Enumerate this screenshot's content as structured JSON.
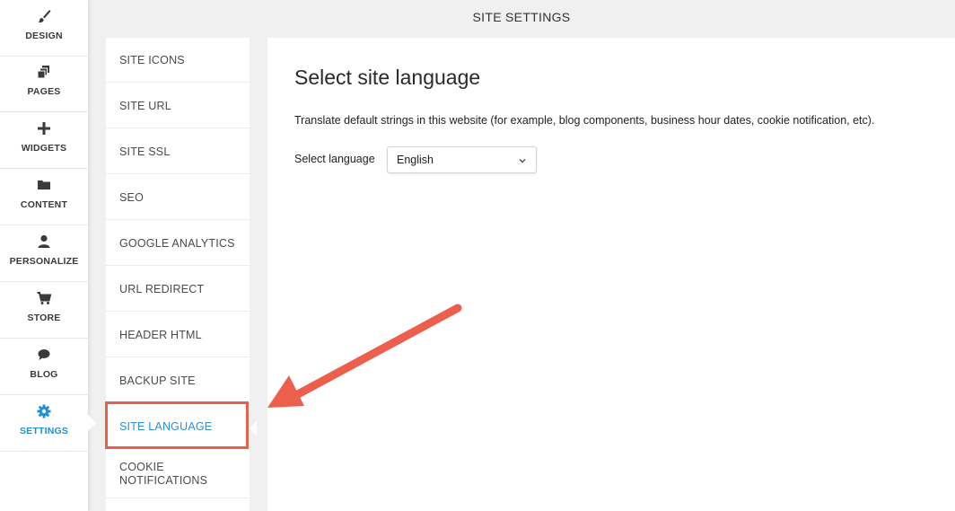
{
  "header": {
    "title": "SITE SETTINGS"
  },
  "sidebar": {
    "items": [
      {
        "label": "DESIGN",
        "icon": "paintbrush-icon"
      },
      {
        "label": "PAGES",
        "icon": "pages-icon"
      },
      {
        "label": "WIDGETS",
        "icon": "plus-icon"
      },
      {
        "label": "CONTENT",
        "icon": "folder-icon"
      },
      {
        "label": "PERSONALIZE",
        "icon": "person-icon"
      },
      {
        "label": "STORE",
        "icon": "cart-icon"
      },
      {
        "label": "BLOG",
        "icon": "speech-bubble-icon"
      },
      {
        "label": "SETTINGS",
        "icon": "gear-icon",
        "active": true
      }
    ]
  },
  "menu": {
    "items": [
      {
        "label": "SITE ICONS"
      },
      {
        "label": "SITE URL"
      },
      {
        "label": "SITE SSL"
      },
      {
        "label": "SEO"
      },
      {
        "label": "GOOGLE ANALYTICS"
      },
      {
        "label": "URL REDIRECT"
      },
      {
        "label": "HEADER HTML"
      },
      {
        "label": "BACKUP SITE"
      },
      {
        "label": "SITE LANGUAGE",
        "active": true
      },
      {
        "label_line1": "COOKIE",
        "label_line2": "NOTIFICATIONS"
      }
    ]
  },
  "content": {
    "title": "Select site language",
    "description": "Translate default strings in this website (for example, blog components, business hour dates, cookie notification, etc).",
    "language_label": "Select language",
    "language_value": "English"
  },
  "colors": {
    "accent": "#1f8fd6",
    "annotation": "#e8604c"
  }
}
